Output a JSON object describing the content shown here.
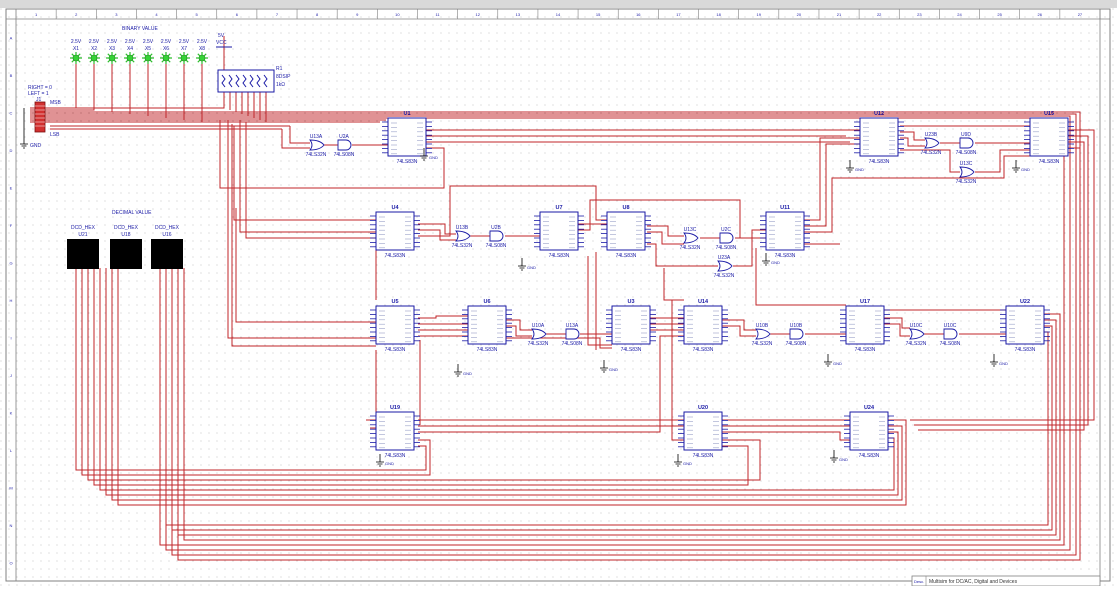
{
  "sheet": {
    "col_numbers": [
      "1",
      "2",
      "3",
      "4",
      "5",
      "6",
      "7",
      "8",
      "9",
      "10",
      "11",
      "12",
      "13",
      "14",
      "15",
      "16",
      "17",
      "18",
      "19",
      "20",
      "21",
      "22",
      "23",
      "24",
      "25",
      "26",
      "27"
    ],
    "row_letters": [
      "A",
      "B",
      "C",
      "D",
      "E",
      "F",
      "G",
      "H",
      "I",
      "J",
      "K",
      "L",
      "M",
      "N",
      "O"
    ],
    "title_block_label": "Desc.",
    "title_block_text": "Multisim for DC/AC, Digital and Devices"
  },
  "header_labels": {
    "binary_value": "BINARY VALUE",
    "decimal_value": "DECIMAL VALUE"
  },
  "probes": [
    {
      "volt": "2.5V",
      "ref": "X1"
    },
    {
      "volt": "2.5V",
      "ref": "X2"
    },
    {
      "volt": "2.5V",
      "ref": "X3"
    },
    {
      "volt": "2.5V",
      "ref": "X4"
    },
    {
      "volt": "2.5V",
      "ref": "X5"
    },
    {
      "volt": "2.5V",
      "ref": "X6"
    },
    {
      "volt": "2.5V",
      "ref": "X7"
    },
    {
      "volt": "2.5V",
      "ref": "X8"
    }
  ],
  "power": {
    "voltage": "5V",
    "name": "VCC"
  },
  "resistor_pack": {
    "ref": "R1",
    "type": "8DSIP",
    "value": "1kΩ"
  },
  "switch": {
    "ref": "J1",
    "right_note": "RIGHT = 0",
    "left_note": "LEFT = 1",
    "msb": "MSB",
    "lsb": "LSB"
  },
  "ground_label": "GND",
  "displays": [
    {
      "type": "DCD_HEX",
      "ref": "U21"
    },
    {
      "type": "DCD_HEX",
      "ref": "U18"
    },
    {
      "type": "DCD_HEX",
      "ref": "U16"
    }
  ],
  "chips": [
    {
      "ref": "U1",
      "part": "74LS83N"
    },
    {
      "ref": "U12",
      "part": "74LS83N"
    },
    {
      "ref": "U15",
      "part": "74LS83N"
    },
    {
      "ref": "U4",
      "part": "74LS83N"
    },
    {
      "ref": "U7",
      "part": "74LS83N"
    },
    {
      "ref": "U8",
      "part": "74LS83N"
    },
    {
      "ref": "U11",
      "part": "74LS83N"
    },
    {
      "ref": "U5",
      "part": "74LS83N"
    },
    {
      "ref": "U6",
      "part": "74LS83N"
    },
    {
      "ref": "U3",
      "part": "74LS83N"
    },
    {
      "ref": "U14",
      "part": "74LS83N"
    },
    {
      "ref": "U17",
      "part": "74LS83N"
    },
    {
      "ref": "U22",
      "part": "74LS83N"
    },
    {
      "ref": "U19",
      "part": "74LS83N"
    },
    {
      "ref": "U20",
      "part": "74LS83N"
    },
    {
      "ref": "U24",
      "part": "74LS83N"
    }
  ],
  "gates": [
    {
      "ref": "U13A",
      "part": "74LS32N"
    },
    {
      "ref": "U2A",
      "part": "74LS08N"
    },
    {
      "ref": "U13B",
      "part": "74LS32N"
    },
    {
      "ref": "U2B",
      "part": "74LS08N"
    },
    {
      "ref": "U13C",
      "part": "74LS32N"
    },
    {
      "ref": "U2C",
      "part": "74LS08N"
    },
    {
      "ref": "U23A",
      "part": "74LS32N"
    },
    {
      "ref": "U23B",
      "part": "74LS32N"
    },
    {
      "ref": "U9D",
      "part": "74LS08N"
    },
    {
      "ref": "U13C",
      "part": "74LS32N"
    },
    {
      "ref": "U10A",
      "part": "74LS32N"
    },
    {
      "ref": "U13A",
      "part": "74LS08N"
    },
    {
      "ref": "U10B",
      "part": "74LS32N"
    },
    {
      "ref": "U10B",
      "part": "74LS08N"
    },
    {
      "ref": "U10C",
      "part": "74LS32N"
    },
    {
      "ref": "U10C",
      "part": "74LS08N"
    }
  ]
}
